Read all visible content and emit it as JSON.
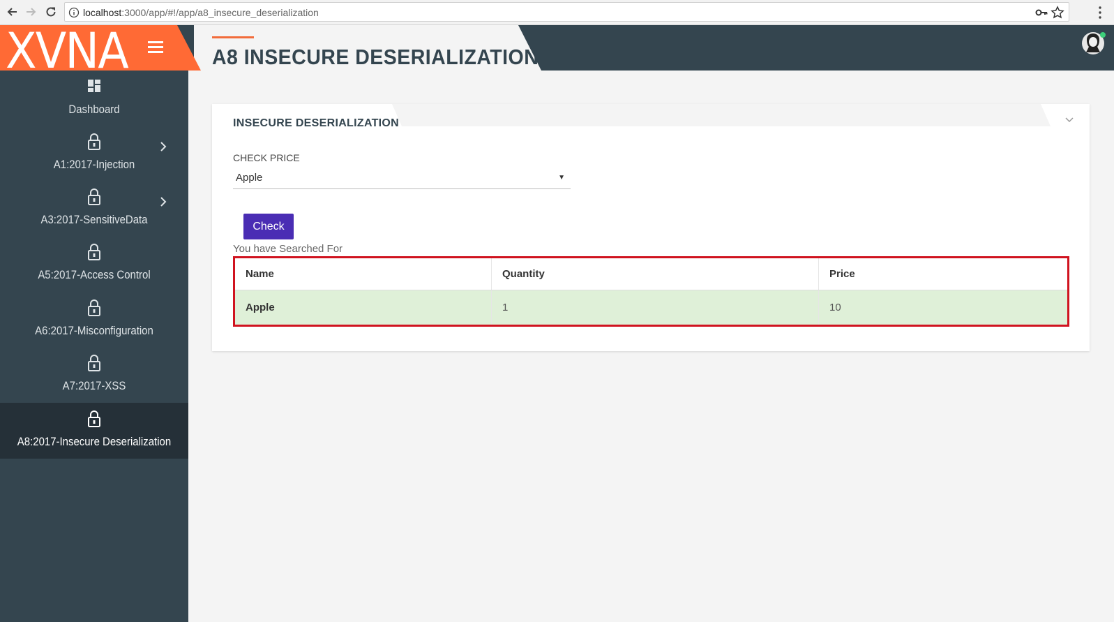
{
  "browser": {
    "url_host": "localhost",
    "url_rest": ":3000/app/#!/app/a8_insecure_deserialization"
  },
  "header": {
    "brand": "XVNA",
    "page_title": "A8 INSECURE DESERIALIZATION",
    "brand_color": "#ff6a35",
    "accent_color": "#f26c3b",
    "header_color": "#34454f"
  },
  "sidebar": {
    "items": [
      {
        "label": "Dashboard",
        "icon": "dashboard-icon",
        "has_chevron": false,
        "active": false
      },
      {
        "label": "A1:2017-Injection",
        "icon": "lock-icon",
        "has_chevron": true,
        "active": false
      },
      {
        "label": "A3:2017-SensitiveData",
        "icon": "lock-icon",
        "has_chevron": true,
        "active": false
      },
      {
        "label": "A5:2017-Access Control",
        "icon": "lock-icon",
        "has_chevron": false,
        "active": false
      },
      {
        "label": "A6:2017-Misconfiguration",
        "icon": "lock-icon",
        "has_chevron": false,
        "active": false
      },
      {
        "label": "A7:2017-XSS",
        "icon": "lock-icon",
        "has_chevron": false,
        "active": false
      },
      {
        "label": "A8:2017-Insecure Deserialization",
        "icon": "lock-icon",
        "has_chevron": false,
        "active": true
      }
    ]
  },
  "card": {
    "title": "INSECURE DESERIALIZATION",
    "field_label": "CHECK PRICE",
    "select_value": "Apple",
    "button_label": "Check",
    "button_color": "#4a2db4",
    "search_note": "You have Searched For",
    "table": {
      "headers": [
        "Name",
        "Quantity",
        "Price"
      ],
      "rows": [
        [
          "Apple",
          "1",
          "10"
        ]
      ],
      "highlight_color": "#d0131f",
      "row_color": "#dff0d8"
    }
  }
}
